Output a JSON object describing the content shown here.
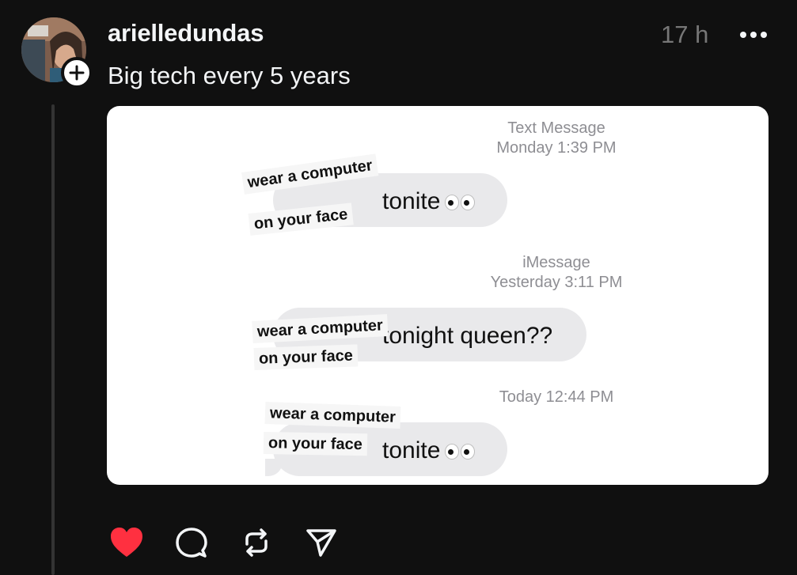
{
  "post": {
    "username": "arielledundas",
    "timestamp": "17 h",
    "caption": "Big tech every 5 years"
  },
  "icons": {
    "follow": "plus-icon",
    "more": "ellipsis-icon",
    "like": "heart-icon",
    "comment": "comment-icon",
    "repost": "repost-icon",
    "share": "send-icon"
  },
  "colors": {
    "background": "#101010",
    "like_active": "#ff3040",
    "bubble": "#e9e9eb",
    "meta_text": "#8e8e93"
  },
  "meme": {
    "messages": [
      {
        "meta_line1": "Text Message",
        "meta_line2": "Monday 1:39 PM",
        "sticker_line1": "wear a computer",
        "sticker_line2": "on your face",
        "text": "tonite"
      },
      {
        "meta_line1": "iMessage",
        "meta_line2": "Yesterday 3:11 PM",
        "sticker_line1": "wear a computer",
        "sticker_line2": "on your face",
        "text": "tonight queen??"
      },
      {
        "meta_line1": "",
        "meta_line2": "Today 12:44 PM",
        "sticker_line1": "wear a computer",
        "sticker_line2": "on your face",
        "text": "tonite"
      }
    ]
  }
}
